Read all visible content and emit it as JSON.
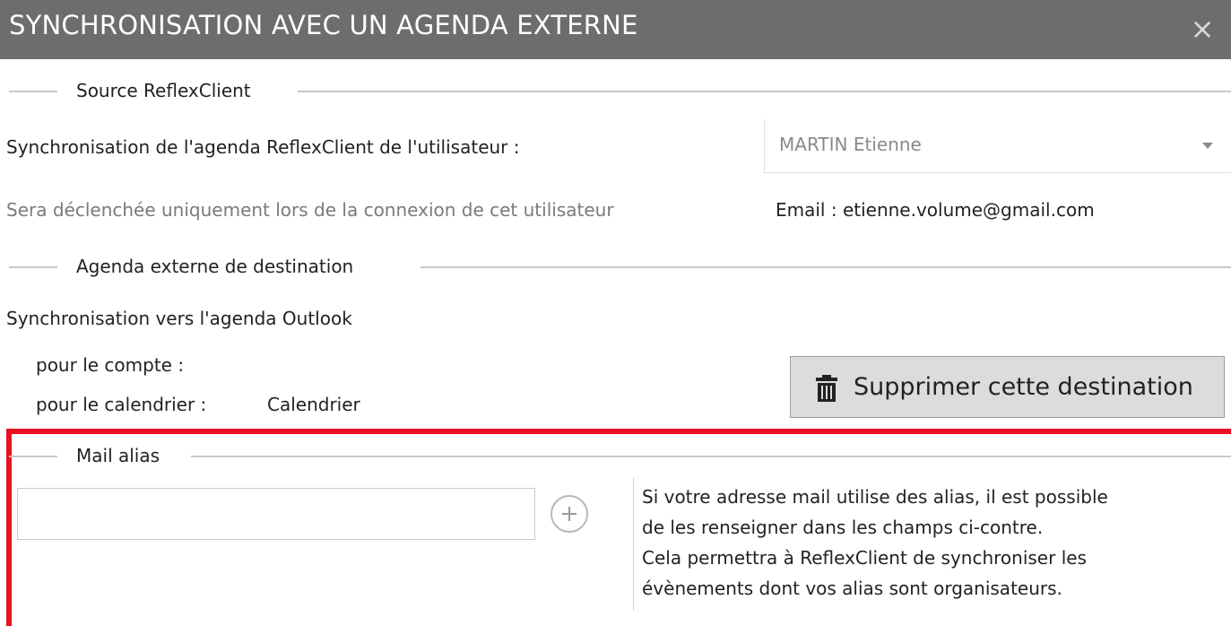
{
  "window": {
    "title": "SYNCHRONISATION AVEC UN AGENDA EXTERNE",
    "close_icon": "close-icon"
  },
  "source": {
    "header": "Source ReflexClient",
    "user_label": "Synchronisation de l'agenda ReflexClient de l'utilisateur :",
    "user_select_value": "MARTIN Etienne",
    "note": "Sera déclenchée uniquement lors de la connexion de cet utilisateur",
    "email": "Email : etienne.volume@gmail.com"
  },
  "destination": {
    "header": "Agenda externe de destination",
    "sync_label": "Synchronisation vers l'agenda Outlook",
    "account_label": "pour le compte :",
    "account_value": "",
    "calendar_label": "pour le calendrier :",
    "calendar_value": "Calendrier",
    "delete_button_label": "Supprimer cette destination",
    "delete_icon": "trash-icon"
  },
  "alias": {
    "header": "Mail alias",
    "input_value": "",
    "add_icon": "plus-circle-icon",
    "help_lines": [
      "Si votre adresse mail utilise des alias, il est possible",
      "de les renseigner dans les champs ci-contre.",
      "Cela permettra à ReflexClient de synchroniser les",
      "évènements dont vos alias sont organisateurs."
    ]
  },
  "colors": {
    "titlebar": "#6d6d6d",
    "highlight_border": "#e81123",
    "button_bg": "#dcdcdc"
  }
}
